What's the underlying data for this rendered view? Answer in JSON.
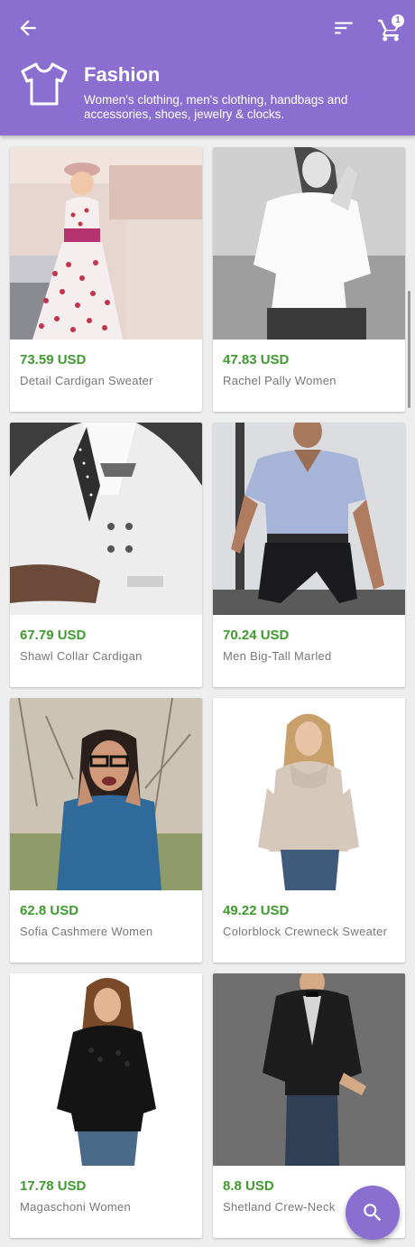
{
  "toolbar": {
    "back_icon": "arrow-back-icon",
    "sort_icon": "sort-icon",
    "cart_icon": "cart-icon",
    "cart_count": "1"
  },
  "category": {
    "icon": "tshirt-icon",
    "title": "Fashion",
    "description": "Women's clothing, men's clothing, handbags and accessories, shoes, jewelry & clocks."
  },
  "products": [
    {
      "price": "73.59 USD",
      "name": "Detail Cardigan Sweater"
    },
    {
      "price": "47.83 USD",
      "name": "Rachel Pally Women"
    },
    {
      "price": "67.79 USD",
      "name": "Shawl Collar Cardigan"
    },
    {
      "price": "70.24 USD",
      "name": "Men Big-Tall Marled"
    },
    {
      "price": "62.8 USD",
      "name": "Sofia Cashmere Women"
    },
    {
      "price": "49.22 USD",
      "name": "Colorblock Crewneck Sweater"
    },
    {
      "price": "17.78 USD",
      "name": "Magaschoni Women"
    },
    {
      "price": "8.8 USD",
      "name": "Shetland Crew-Neck"
    }
  ],
  "fab": {
    "icon": "search-icon"
  },
  "colors": {
    "primary": "#8a6fd1",
    "price": "#3f9a2f"
  }
}
